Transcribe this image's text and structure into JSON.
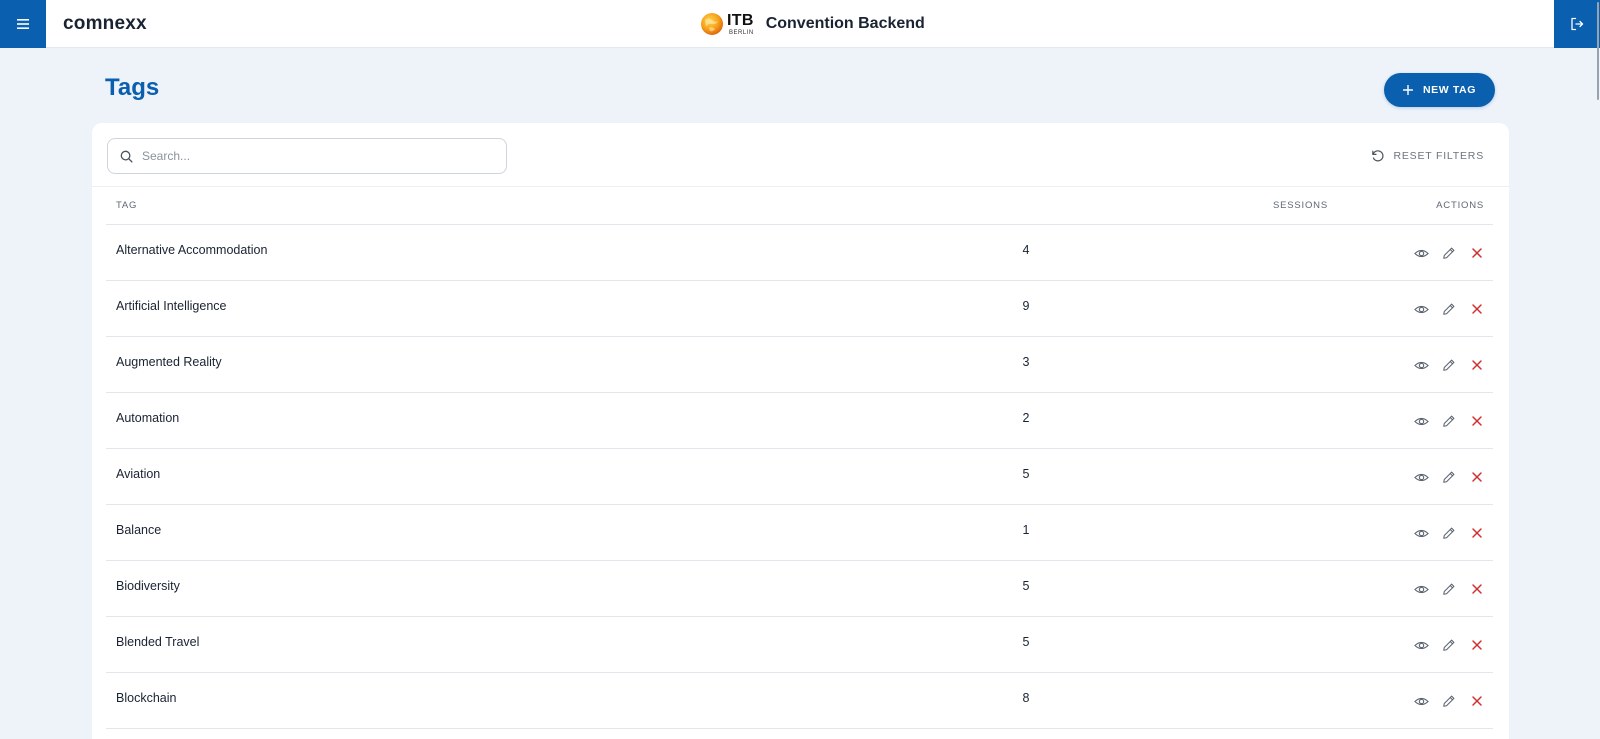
{
  "header": {
    "brand": "comnexx",
    "logo_itb": "ITB",
    "logo_city": "BERLIN",
    "app_title": "Convention Backend"
  },
  "page": {
    "title": "Tags",
    "new_button_label": "NEW TAG"
  },
  "filters": {
    "search_placeholder": "Search...",
    "search_value": "",
    "reset_label": "RESET FILTERS"
  },
  "table": {
    "columns": {
      "tag": "TAG",
      "sessions": "SESSIONS",
      "actions": "ACTIONS"
    },
    "rows": [
      {
        "tag": "Alternative Accommodation",
        "sessions": "4"
      },
      {
        "tag": "Artificial Intelligence",
        "sessions": "9"
      },
      {
        "tag": "Augmented Reality",
        "sessions": "3"
      },
      {
        "tag": "Automation",
        "sessions": "2"
      },
      {
        "tag": "Aviation",
        "sessions": "5"
      },
      {
        "tag": "Balance",
        "sessions": "1"
      },
      {
        "tag": "Biodiversity",
        "sessions": "5"
      },
      {
        "tag": "Blended Travel",
        "sessions": "5"
      },
      {
        "tag": "Blockchain",
        "sessions": "8"
      }
    ]
  },
  "icons": {
    "menu": "hamburger-icon",
    "logout": "logout-icon",
    "search": "search-icon",
    "reset": "reset-icon",
    "view": "eye-icon",
    "edit": "pencil-icon",
    "delete": "close-icon",
    "add": "plus-icon"
  },
  "colors": {
    "primary": "#0a5fae",
    "delete": "#d32f2f",
    "background": "#eef2f9"
  }
}
